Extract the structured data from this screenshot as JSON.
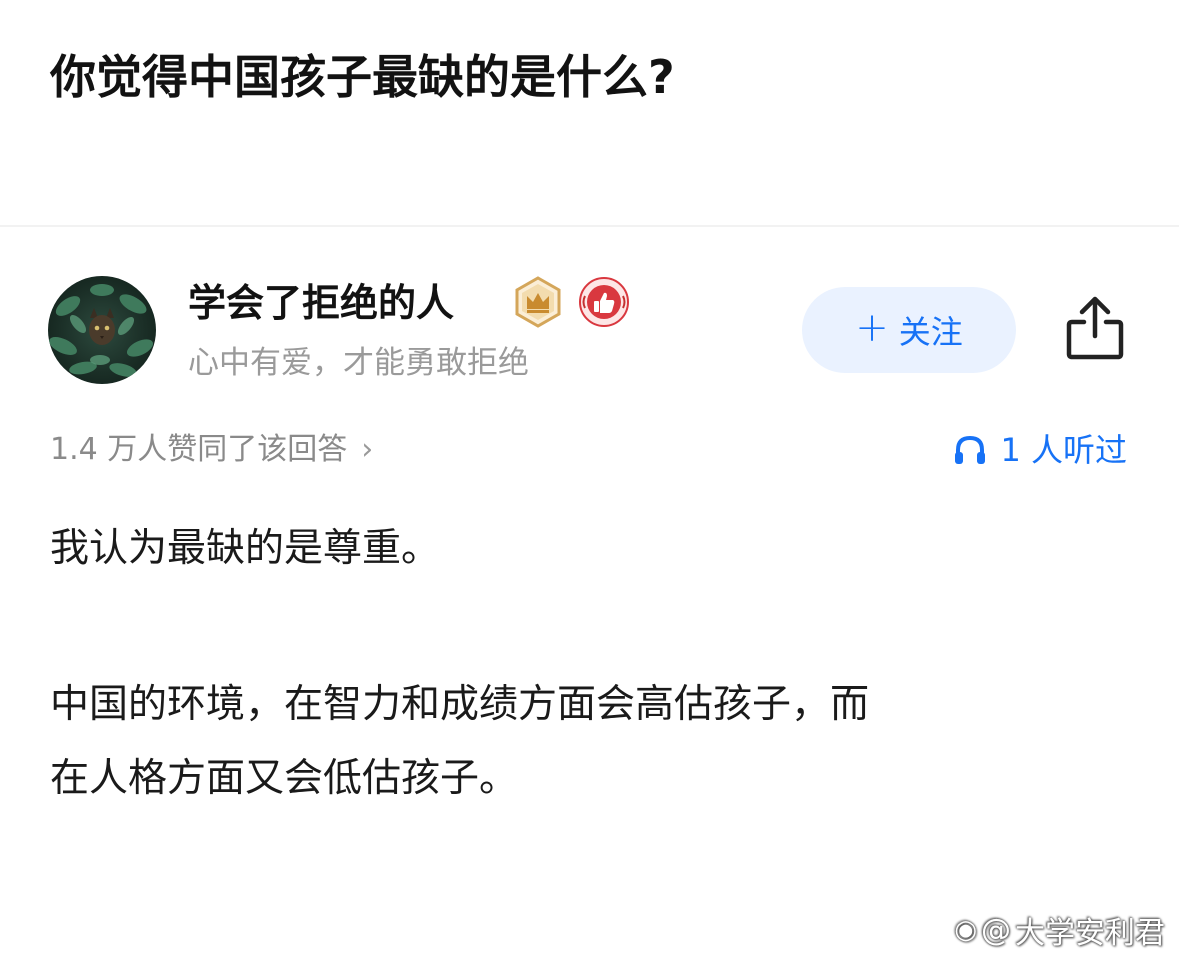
{
  "question": {
    "title": "你觉得中国孩子最缺的是什么?"
  },
  "author": {
    "name": "学会了拒绝的人",
    "bio": "心中有爱，才能勇敢拒绝",
    "follow_label": "关注"
  },
  "stats": {
    "votes": "1.4 万人赞同了该回答",
    "listens": "1 人听过"
  },
  "answer": {
    "paragraphs": [
      "我认为最缺的是尊重。",
      "中国的环境，在智力和成绩方面会高估孩子，而",
      "在人格方面又会低估孩子。"
    ]
  },
  "watermark": {
    "icon": "@",
    "text": "大学安利君"
  },
  "colors": {
    "accent": "#1772f6",
    "follow_bg": "#eaf2ff",
    "muted_text": "#9a9a9a",
    "badge_gold": "#d4a65a",
    "badge_red": "#d9383f"
  },
  "icons": {
    "avatar": "cat-in-leaves-avatar",
    "badge1": "crown-badge-icon",
    "badge2": "thumbs-up-badge-icon",
    "share": "share-icon",
    "listen": "headphones-icon",
    "chevron": "chevron-right-icon"
  }
}
